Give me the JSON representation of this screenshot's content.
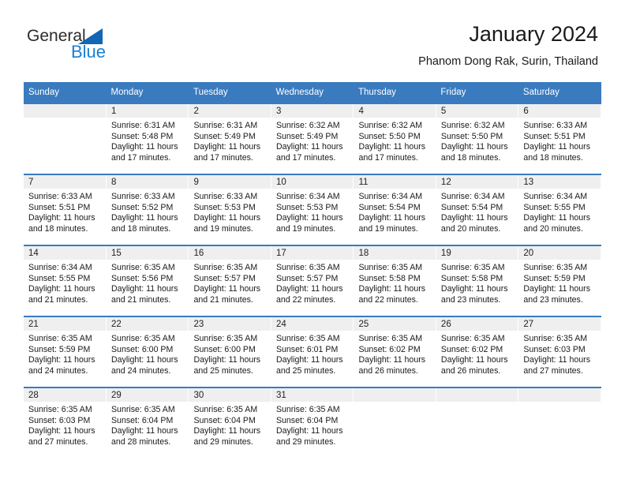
{
  "brand": {
    "name_part1": "General",
    "name_part2": "Blue",
    "accent_color": "#1a7fd4",
    "triangle_color": "#1266b3"
  },
  "header": {
    "title": "January 2024",
    "subtitle": "Phanom Dong Rak, Surin, Thailand"
  },
  "calendar": {
    "header_color": "#3a7bbf",
    "weekday_headers": [
      "Sunday",
      "Monday",
      "Tuesday",
      "Wednesday",
      "Thursday",
      "Friday",
      "Saturday"
    ],
    "weeks": [
      [
        {
          "day": "",
          "sunrise": "",
          "sunset": "",
          "daylight1": "",
          "daylight2": ""
        },
        {
          "day": "1",
          "sunrise": "Sunrise: 6:31 AM",
          "sunset": "Sunset: 5:48 PM",
          "daylight1": "Daylight: 11 hours",
          "daylight2": "and 17 minutes."
        },
        {
          "day": "2",
          "sunrise": "Sunrise: 6:31 AM",
          "sunset": "Sunset: 5:49 PM",
          "daylight1": "Daylight: 11 hours",
          "daylight2": "and 17 minutes."
        },
        {
          "day": "3",
          "sunrise": "Sunrise: 6:32 AM",
          "sunset": "Sunset: 5:49 PM",
          "daylight1": "Daylight: 11 hours",
          "daylight2": "and 17 minutes."
        },
        {
          "day": "4",
          "sunrise": "Sunrise: 6:32 AM",
          "sunset": "Sunset: 5:50 PM",
          "daylight1": "Daylight: 11 hours",
          "daylight2": "and 17 minutes."
        },
        {
          "day": "5",
          "sunrise": "Sunrise: 6:32 AM",
          "sunset": "Sunset: 5:50 PM",
          "daylight1": "Daylight: 11 hours",
          "daylight2": "and 18 minutes."
        },
        {
          "day": "6",
          "sunrise": "Sunrise: 6:33 AM",
          "sunset": "Sunset: 5:51 PM",
          "daylight1": "Daylight: 11 hours",
          "daylight2": "and 18 minutes."
        }
      ],
      [
        {
          "day": "7",
          "sunrise": "Sunrise: 6:33 AM",
          "sunset": "Sunset: 5:51 PM",
          "daylight1": "Daylight: 11 hours",
          "daylight2": "and 18 minutes."
        },
        {
          "day": "8",
          "sunrise": "Sunrise: 6:33 AM",
          "sunset": "Sunset: 5:52 PM",
          "daylight1": "Daylight: 11 hours",
          "daylight2": "and 18 minutes."
        },
        {
          "day": "9",
          "sunrise": "Sunrise: 6:33 AM",
          "sunset": "Sunset: 5:53 PM",
          "daylight1": "Daylight: 11 hours",
          "daylight2": "and 19 minutes."
        },
        {
          "day": "10",
          "sunrise": "Sunrise: 6:34 AM",
          "sunset": "Sunset: 5:53 PM",
          "daylight1": "Daylight: 11 hours",
          "daylight2": "and 19 minutes."
        },
        {
          "day": "11",
          "sunrise": "Sunrise: 6:34 AM",
          "sunset": "Sunset: 5:54 PM",
          "daylight1": "Daylight: 11 hours",
          "daylight2": "and 19 minutes."
        },
        {
          "day": "12",
          "sunrise": "Sunrise: 6:34 AM",
          "sunset": "Sunset: 5:54 PM",
          "daylight1": "Daylight: 11 hours",
          "daylight2": "and 20 minutes."
        },
        {
          "day": "13",
          "sunrise": "Sunrise: 6:34 AM",
          "sunset": "Sunset: 5:55 PM",
          "daylight1": "Daylight: 11 hours",
          "daylight2": "and 20 minutes."
        }
      ],
      [
        {
          "day": "14",
          "sunrise": "Sunrise: 6:34 AM",
          "sunset": "Sunset: 5:55 PM",
          "daylight1": "Daylight: 11 hours",
          "daylight2": "and 21 minutes."
        },
        {
          "day": "15",
          "sunrise": "Sunrise: 6:35 AM",
          "sunset": "Sunset: 5:56 PM",
          "daylight1": "Daylight: 11 hours",
          "daylight2": "and 21 minutes."
        },
        {
          "day": "16",
          "sunrise": "Sunrise: 6:35 AM",
          "sunset": "Sunset: 5:57 PM",
          "daylight1": "Daylight: 11 hours",
          "daylight2": "and 21 minutes."
        },
        {
          "day": "17",
          "sunrise": "Sunrise: 6:35 AM",
          "sunset": "Sunset: 5:57 PM",
          "daylight1": "Daylight: 11 hours",
          "daylight2": "and 22 minutes."
        },
        {
          "day": "18",
          "sunrise": "Sunrise: 6:35 AM",
          "sunset": "Sunset: 5:58 PM",
          "daylight1": "Daylight: 11 hours",
          "daylight2": "and 22 minutes."
        },
        {
          "day": "19",
          "sunrise": "Sunrise: 6:35 AM",
          "sunset": "Sunset: 5:58 PM",
          "daylight1": "Daylight: 11 hours",
          "daylight2": "and 23 minutes."
        },
        {
          "day": "20",
          "sunrise": "Sunrise: 6:35 AM",
          "sunset": "Sunset: 5:59 PM",
          "daylight1": "Daylight: 11 hours",
          "daylight2": "and 23 minutes."
        }
      ],
      [
        {
          "day": "21",
          "sunrise": "Sunrise: 6:35 AM",
          "sunset": "Sunset: 5:59 PM",
          "daylight1": "Daylight: 11 hours",
          "daylight2": "and 24 minutes."
        },
        {
          "day": "22",
          "sunrise": "Sunrise: 6:35 AM",
          "sunset": "Sunset: 6:00 PM",
          "daylight1": "Daylight: 11 hours",
          "daylight2": "and 24 minutes."
        },
        {
          "day": "23",
          "sunrise": "Sunrise: 6:35 AM",
          "sunset": "Sunset: 6:00 PM",
          "daylight1": "Daylight: 11 hours",
          "daylight2": "and 25 minutes."
        },
        {
          "day": "24",
          "sunrise": "Sunrise: 6:35 AM",
          "sunset": "Sunset: 6:01 PM",
          "daylight1": "Daylight: 11 hours",
          "daylight2": "and 25 minutes."
        },
        {
          "day": "25",
          "sunrise": "Sunrise: 6:35 AM",
          "sunset": "Sunset: 6:02 PM",
          "daylight1": "Daylight: 11 hours",
          "daylight2": "and 26 minutes."
        },
        {
          "day": "26",
          "sunrise": "Sunrise: 6:35 AM",
          "sunset": "Sunset: 6:02 PM",
          "daylight1": "Daylight: 11 hours",
          "daylight2": "and 26 minutes."
        },
        {
          "day": "27",
          "sunrise": "Sunrise: 6:35 AM",
          "sunset": "Sunset: 6:03 PM",
          "daylight1": "Daylight: 11 hours",
          "daylight2": "and 27 minutes."
        }
      ],
      [
        {
          "day": "28",
          "sunrise": "Sunrise: 6:35 AM",
          "sunset": "Sunset: 6:03 PM",
          "daylight1": "Daylight: 11 hours",
          "daylight2": "and 27 minutes."
        },
        {
          "day": "29",
          "sunrise": "Sunrise: 6:35 AM",
          "sunset": "Sunset: 6:04 PM",
          "daylight1": "Daylight: 11 hours",
          "daylight2": "and 28 minutes."
        },
        {
          "day": "30",
          "sunrise": "Sunrise: 6:35 AM",
          "sunset": "Sunset: 6:04 PM",
          "daylight1": "Daylight: 11 hours",
          "daylight2": "and 29 minutes."
        },
        {
          "day": "31",
          "sunrise": "Sunrise: 6:35 AM",
          "sunset": "Sunset: 6:04 PM",
          "daylight1": "Daylight: 11 hours",
          "daylight2": "and 29 minutes."
        },
        {
          "day": "",
          "sunrise": "",
          "sunset": "",
          "daylight1": "",
          "daylight2": ""
        },
        {
          "day": "",
          "sunrise": "",
          "sunset": "",
          "daylight1": "",
          "daylight2": ""
        },
        {
          "day": "",
          "sunrise": "",
          "sunset": "",
          "daylight1": "",
          "daylight2": ""
        }
      ]
    ]
  }
}
